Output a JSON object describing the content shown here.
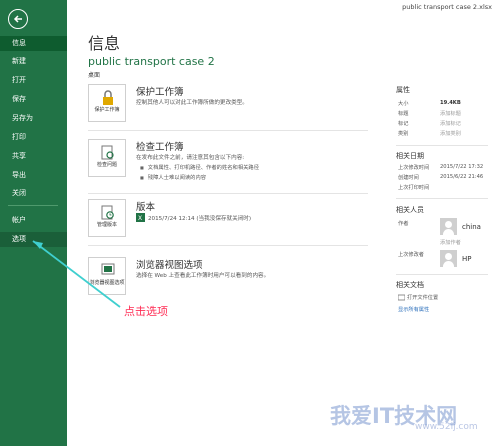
{
  "title_bar": "public transport case 2.xlsx",
  "sidebar": {
    "items": [
      {
        "label": "信息"
      },
      {
        "label": "新建"
      },
      {
        "label": "打开"
      },
      {
        "label": "保存"
      },
      {
        "label": "另存为"
      },
      {
        "label": "打印"
      },
      {
        "label": "共享"
      },
      {
        "label": "导出"
      },
      {
        "label": "关闭"
      },
      {
        "label": "帐户"
      },
      {
        "label": "选项"
      }
    ]
  },
  "main": {
    "title": "信息",
    "doc_name": "public transport case 2",
    "doc_location": "桌面",
    "sections": [
      {
        "icon_label": "保护工作簿",
        "title": "保护工作簿",
        "desc": "控制其他人可以对此工作簿所做的更改类型。",
        "bullets": []
      },
      {
        "icon_label": "检查问题",
        "title": "检查工作簿",
        "desc": "在发布此文件之前，请注意其包含以下内容:",
        "bullets": [
          "文档属性、打印机路径、作者的姓名和相关路径",
          "残障人士难以阅读的内容"
        ]
      },
      {
        "icon_label": "管理版本",
        "title": "版本",
        "desc": "2015/7/24 12:14 (当我没保存就关闭时)",
        "bullets": []
      },
      {
        "icon_label": "浏览器视图选项",
        "title": "浏览器视图选项",
        "desc": "选择在 Web 上查看此工作簿时用户可以看到的内容。",
        "bullets": []
      }
    ]
  },
  "properties": {
    "heading": "属性",
    "rows": [
      {
        "label": "大小",
        "value": "19.4KB"
      },
      {
        "label": "标题",
        "value": "添加标题"
      },
      {
        "label": "标记",
        "value": "添加标记"
      },
      {
        "label": "类别",
        "value": "添加类别"
      }
    ],
    "dates_heading": "相关日期",
    "date_rows": [
      {
        "label": "上次修改时间",
        "value": "2015/7/22 17:32"
      },
      {
        "label": "创建时间",
        "value": "2015/6/22 21:46"
      },
      {
        "label": "上次打印时间",
        "value": ""
      }
    ],
    "people_heading": "相关人员",
    "author_label": "作者",
    "author_name": "china",
    "add_author": "添加作者",
    "last_modified_by_label": "上次修改者",
    "last_modified_by": "HP",
    "docs_heading": "相关文档",
    "open_location": "打开文件位置",
    "show_all": "显示所有属性"
  },
  "annotation": "点击选项",
  "watermark": "我爱IT技术网",
  "watermark_sub": "www.52ij.com",
  "colors": {
    "sidebar": "#217346",
    "accent_link": "#2a6ebb",
    "annotation": "#ff2d55"
  }
}
